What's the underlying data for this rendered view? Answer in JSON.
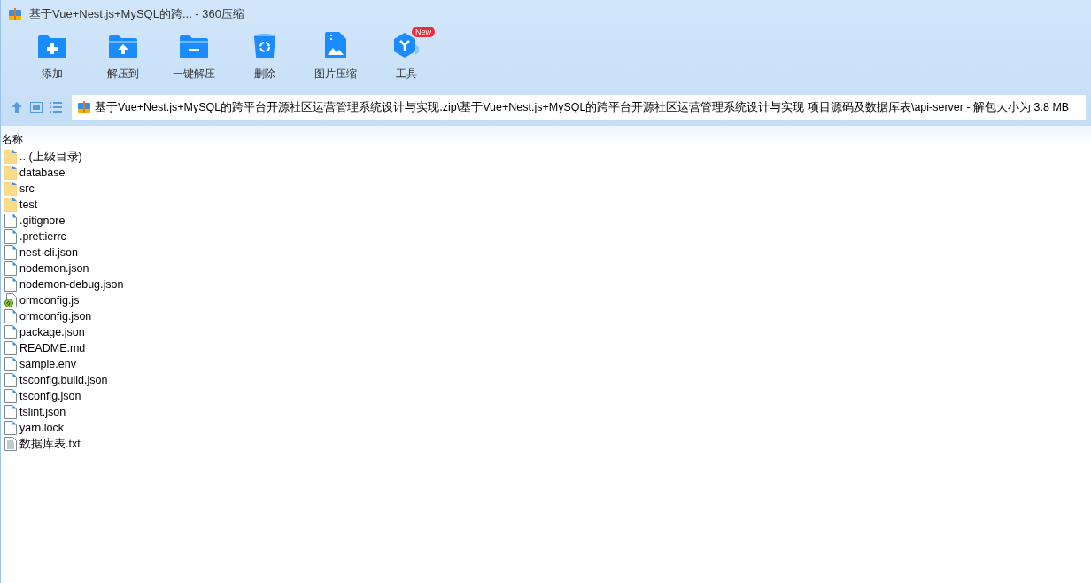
{
  "window": {
    "title": "基于Vue+Nest.js+MySQL的跨... - 360压缩"
  },
  "toolbar": [
    {
      "kind": "add",
      "label": "添加"
    },
    {
      "kind": "extract",
      "label": "解压到"
    },
    {
      "kind": "oneclick",
      "label": "一键解压"
    },
    {
      "kind": "delete",
      "label": "删除"
    },
    {
      "kind": "image",
      "label": "图片压缩"
    },
    {
      "kind": "tools",
      "label": "工具",
      "badge": "New"
    }
  ],
  "address": {
    "path": "基于Vue+Nest.js+MySQL的跨平台开源社区运营管理系统设计与实现.zip\\基于Vue+Nest.js+MySQL的跨平台开源社区运营管理系统设计与实现 项目源码及数据库表\\api-server - 解包大小为 3.8 MB"
  },
  "table": {
    "columns": [
      "名称"
    ],
    "rows": [
      {
        "kind": "folder",
        "name": ".. (上级目录)"
      },
      {
        "kind": "folder",
        "name": "database"
      },
      {
        "kind": "folder",
        "name": "src"
      },
      {
        "kind": "folder",
        "name": "test"
      },
      {
        "kind": "file",
        "name": ".gitignore"
      },
      {
        "kind": "file",
        "name": ".prettierrc"
      },
      {
        "kind": "file",
        "name": "nest-cli.json"
      },
      {
        "kind": "file",
        "name": "nodemon.json"
      },
      {
        "kind": "file",
        "name": "nodemon-debug.json"
      },
      {
        "kind": "script",
        "name": "ormconfig.js"
      },
      {
        "kind": "file",
        "name": "ormconfig.json"
      },
      {
        "kind": "file",
        "name": "package.json"
      },
      {
        "kind": "file",
        "name": "README.md"
      },
      {
        "kind": "file",
        "name": "sample.env"
      },
      {
        "kind": "file",
        "name": "tsconfig.build.json"
      },
      {
        "kind": "file",
        "name": "tsconfig.json"
      },
      {
        "kind": "file",
        "name": "tslint.json"
      },
      {
        "kind": "file",
        "name": "yarn.lock"
      },
      {
        "kind": "text",
        "name": "数据库表.txt"
      }
    ]
  }
}
